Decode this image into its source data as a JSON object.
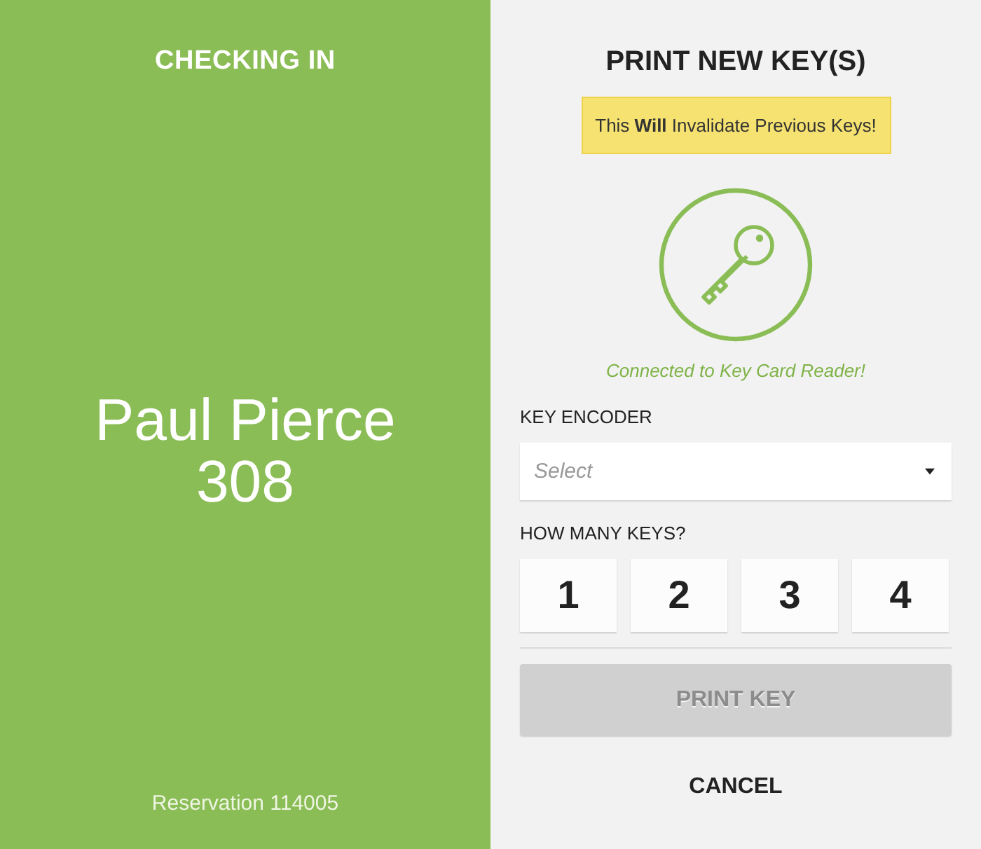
{
  "checkin_panel": {
    "title": "CHECKING IN",
    "guest_name": "Paul Pierce",
    "room": "308",
    "reservation": "Reservation 114005"
  },
  "print_panel": {
    "title": "PRINT NEW KEY(S)",
    "warning": "This **Will** Invalidate Previous Keys!",
    "reader_status": "Connected to Key Card Reader!"
  },
  "key_encoder": {
    "label": "KEY ENCODER",
    "placeholder": "Select"
  },
  "key_count": {
    "label": "HOW MANY KEYS?",
    "options": [
      {
        "label": "1",
        "selected": false
      },
      {
        "label": "2",
        "selected": false
      },
      {
        "label": "3",
        "selected": false
      },
      {
        "label": "4",
        "selected": false
      }
    ]
  },
  "print_button": {
    "label": "PRINT KEY",
    "disabled": true
  },
  "cancel_button": {
    "label": "CANCEL"
  }
}
